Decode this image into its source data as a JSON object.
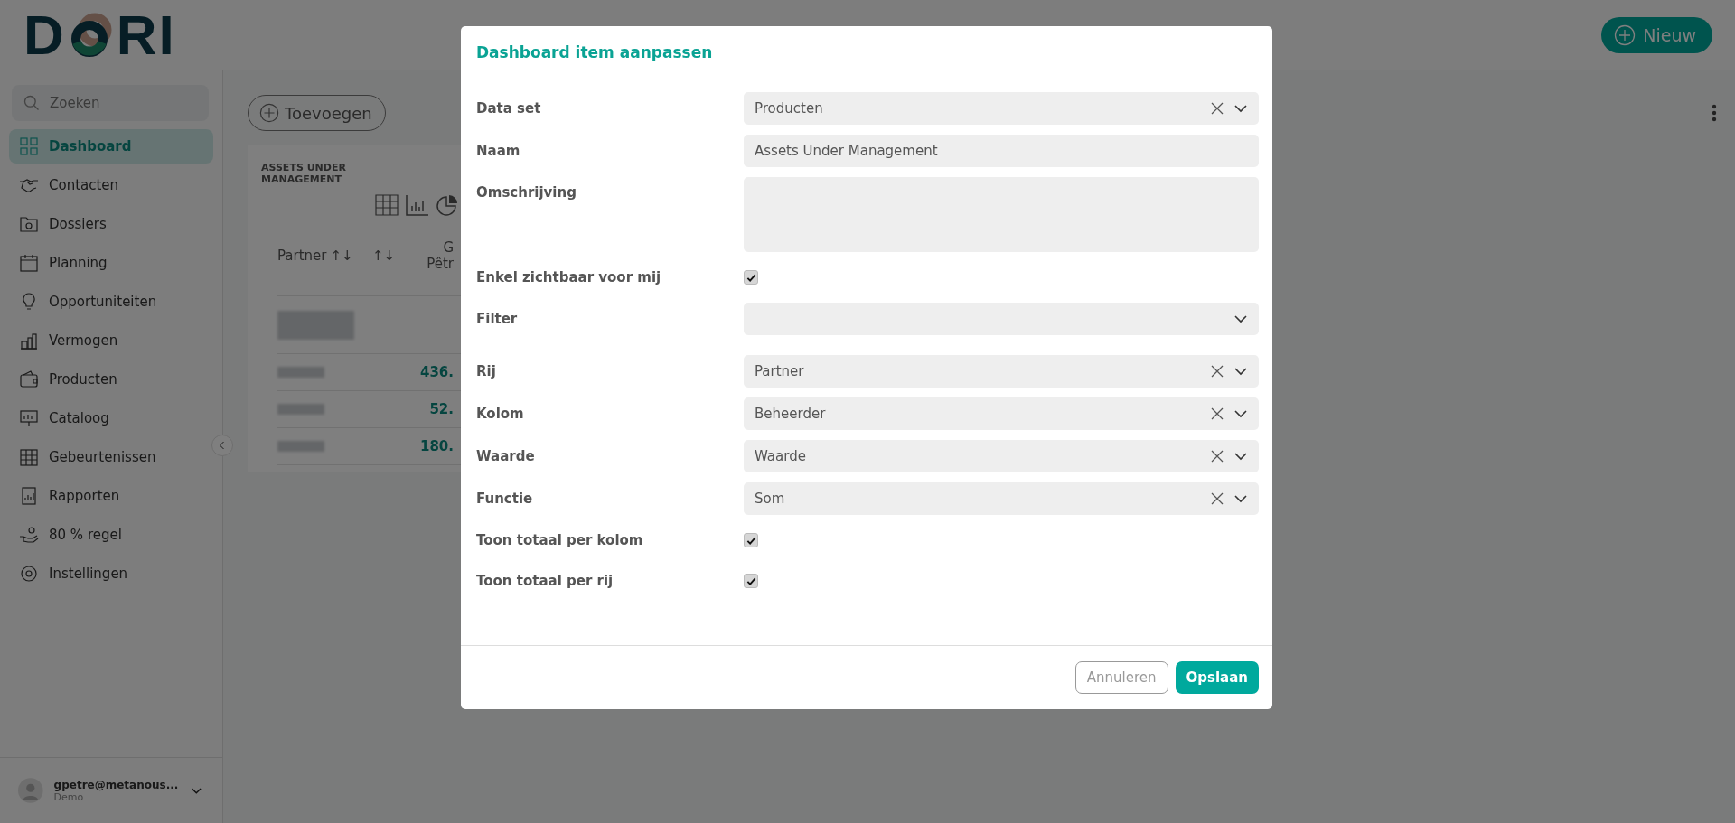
{
  "logo": {
    "left": "D",
    "right": "RI"
  },
  "header": {
    "new_button": "Nieuw"
  },
  "sidebar": {
    "search": {
      "placeholder": "Zoeken"
    },
    "items": [
      {
        "label": "Dashboard",
        "selected": true
      },
      {
        "label": "Contacten",
        "selected": false
      },
      {
        "label": "Dossiers",
        "selected": false
      },
      {
        "label": "Planning",
        "selected": false
      },
      {
        "label": "Opportuniteiten",
        "selected": false
      },
      {
        "label": "Vermogen",
        "selected": false
      },
      {
        "label": "Producten",
        "selected": false
      },
      {
        "label": "Cataloog",
        "selected": false
      },
      {
        "label": "Gebeurtenissen",
        "selected": false
      },
      {
        "label": "Rapporten",
        "selected": false
      },
      {
        "label": "80 % regel",
        "selected": false
      },
      {
        "label": "Instellingen",
        "selected": false
      }
    ],
    "user": {
      "email": "gpetre@metanous...",
      "role": "Demo"
    }
  },
  "main": {
    "add_button": "Toevoegen",
    "card": {
      "title": "ASSETS UNDER MANAGEMENT",
      "columns": [
        {
          "label": "Partner",
          "sort": "↑↓"
        },
        {
          "label": "↑↓"
        },
        {
          "label": "G",
          "label_2": "Pêtr"
        }
      ],
      "rows": [
        {
          "tall": true
        },
        {
          "tall": false,
          "value": "436."
        },
        {
          "tall": false,
          "value": "52."
        },
        {
          "tall": false,
          "value": "180."
        }
      ]
    }
  },
  "modal": {
    "title": "Dashboard item aanpassen",
    "fields": [
      {
        "label": "Data set",
        "kind": "select",
        "value": "Producten",
        "clearable": true
      },
      {
        "label": "Naam",
        "kind": "text",
        "value": "Assets Under Management"
      },
      {
        "label": "Omschrijving",
        "kind": "textarea"
      },
      {
        "label": "Enkel zichtbaar voor mij",
        "kind": "checkbox",
        "checked": true
      },
      {
        "label": "Filter",
        "kind": "select",
        "clearable": false
      },
      {
        "label": "Rij",
        "kind": "select",
        "value": "Partner",
        "clearable": true
      },
      {
        "label": "Kolom",
        "kind": "select",
        "value": "Beheerder",
        "clearable": true
      },
      {
        "label": "Waarde",
        "kind": "select",
        "value": "Waarde",
        "clearable": true
      },
      {
        "label": "Functie",
        "kind": "select",
        "value": "Som",
        "clearable": true
      },
      {
        "label": "Toon totaal per kolom",
        "kind": "checkbox",
        "checked": true
      },
      {
        "label": "Toon totaal per rij",
        "kind": "checkbox",
        "checked": true
      }
    ],
    "buttons": {
      "cancel": "Annuleren",
      "save": "Opslaan"
    }
  }
}
